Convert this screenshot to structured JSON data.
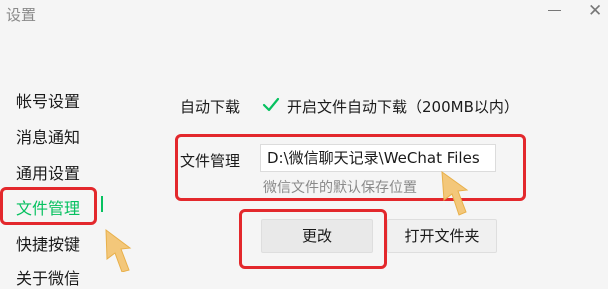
{
  "window": {
    "title": "设置",
    "minimize": "minimize",
    "close": "close"
  },
  "sidebar": {
    "items": [
      {
        "label": "帐号设置"
      },
      {
        "label": "消息通知"
      },
      {
        "label": "通用设置"
      },
      {
        "label": "文件管理",
        "active": true
      },
      {
        "label": "快捷按键"
      },
      {
        "label": "关于微信"
      }
    ]
  },
  "file_settings": {
    "auto_download_label": "自动下载",
    "auto_download_option": "开启文件自动下载（200MB以内）",
    "auto_download_checked": true,
    "file_management_label": "文件管理",
    "path_value": "D:\\微信聊天记录\\WeChat Files",
    "path_hint": "微信文件的默认保存位置",
    "change_button": "更改",
    "open_folder_button": "打开文件夹"
  },
  "colors": {
    "accent": "#07c160",
    "highlight": "#e3282c",
    "arrow": "#f3c77a"
  }
}
